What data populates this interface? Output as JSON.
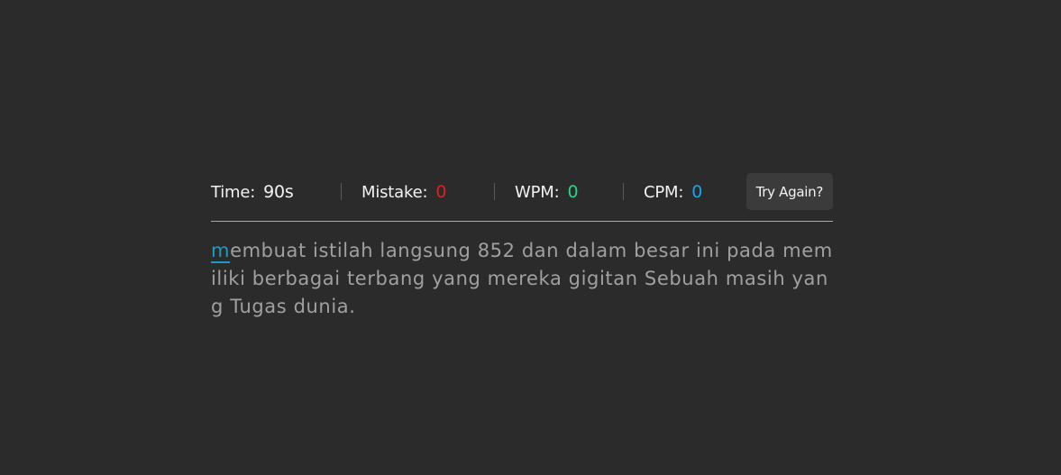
{
  "stats": {
    "time_label": "Time:",
    "time_value": "90s",
    "mistake_label": "Mistake:",
    "mistake_value": "0",
    "wpm_label": "WPM:",
    "wpm_value": "0",
    "cpm_label": "CPM:",
    "cpm_value": "0"
  },
  "try_again_label": "Try Again?",
  "typing": {
    "current_char": "m",
    "remaining_text": "embuat istilah langsung 852 dan dalam besar ini pada memiliki berbagai terbang yang mereka gigitan Sebuah masih yang Tugas dunia."
  },
  "colors": {
    "background": "#2b2b2b",
    "mistake": "#e02020",
    "wpm": "#1fd98a",
    "cpm": "#12a8ee",
    "active_char": "#1e9bc4"
  }
}
